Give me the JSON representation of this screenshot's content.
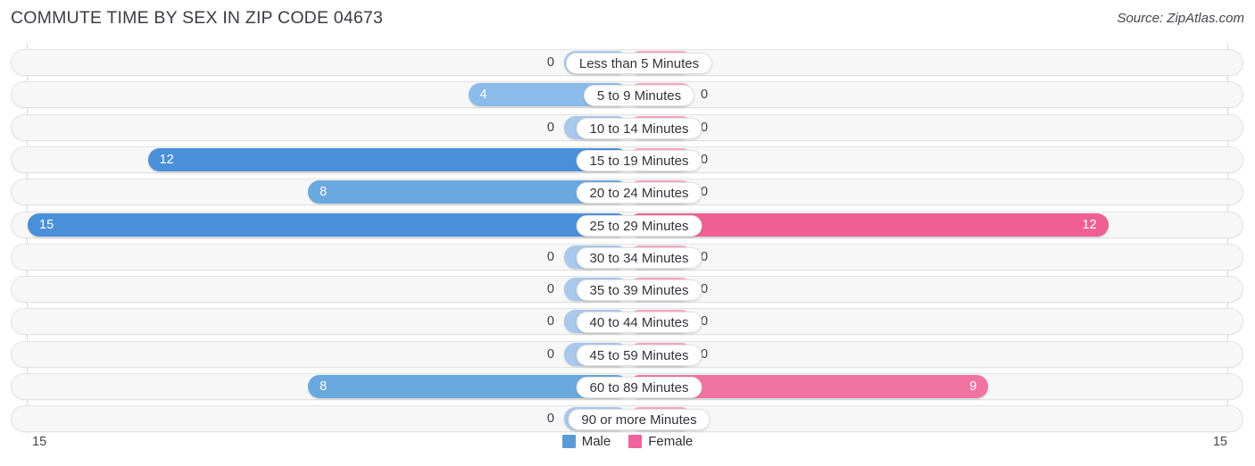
{
  "header": {
    "title": "COMMUTE TIME BY SEX IN ZIP CODE 04673",
    "source": "Source: ZipAtlas.com"
  },
  "axis": {
    "left_scale_label": "15",
    "right_scale_label": "15"
  },
  "legend": {
    "items": [
      {
        "label": "Male",
        "color": "#5b9bd5"
      },
      {
        "label": "Female",
        "color": "#f2629f"
      }
    ]
  },
  "colors": {
    "male_high": "#4a90d9",
    "male_mid": "#6aa8e0",
    "male_low": "#8bbbe8",
    "male_zero": "#a8c8ec",
    "female_high": "#ef5f93",
    "female_mid": "#f173a2",
    "female_low": "#f78cb4",
    "female_zero": "#f8a6c4",
    "track": "#f7f7f7",
    "track_border": "#e3e3e3",
    "axis": "#d9d9d9",
    "title": "#3c3c46"
  },
  "chart_data": {
    "type": "bar",
    "title": "COMMUTE TIME BY SEX IN ZIP CODE 04673",
    "subtitle": "",
    "orientation": "horizontal-diverging",
    "xlabel": "",
    "ylabel": "",
    "axis_max": 15,
    "xlim": [
      15,
      15
    ],
    "grid": false,
    "legend_position": "bottom-center",
    "categories": [
      "Less than 5 Minutes",
      "5 to 9 Minutes",
      "10 to 14 Minutes",
      "15 to 19 Minutes",
      "20 to 24 Minutes",
      "25 to 29 Minutes",
      "30 to 34 Minutes",
      "35 to 39 Minutes",
      "40 to 44 Minutes",
      "45 to 59 Minutes",
      "60 to 89 Minutes",
      "90 or more Minutes"
    ],
    "series": [
      {
        "name": "Male",
        "values": [
          0,
          4,
          0,
          12,
          8,
          15,
          0,
          0,
          0,
          0,
          8,
          0
        ],
        "labels": [
          "0",
          "4",
          "0",
          "12",
          "8",
          "15",
          "0",
          "0",
          "0",
          "0",
          "8",
          "0"
        ]
      },
      {
        "name": "Female",
        "values": [
          0,
          0,
          0,
          0,
          0,
          12,
          0,
          0,
          0,
          0,
          9,
          0
        ],
        "labels": [
          "0",
          "0",
          "0",
          "0",
          "0",
          "12",
          "0",
          "0",
          "0",
          "0",
          "9",
          "0"
        ]
      }
    ]
  }
}
